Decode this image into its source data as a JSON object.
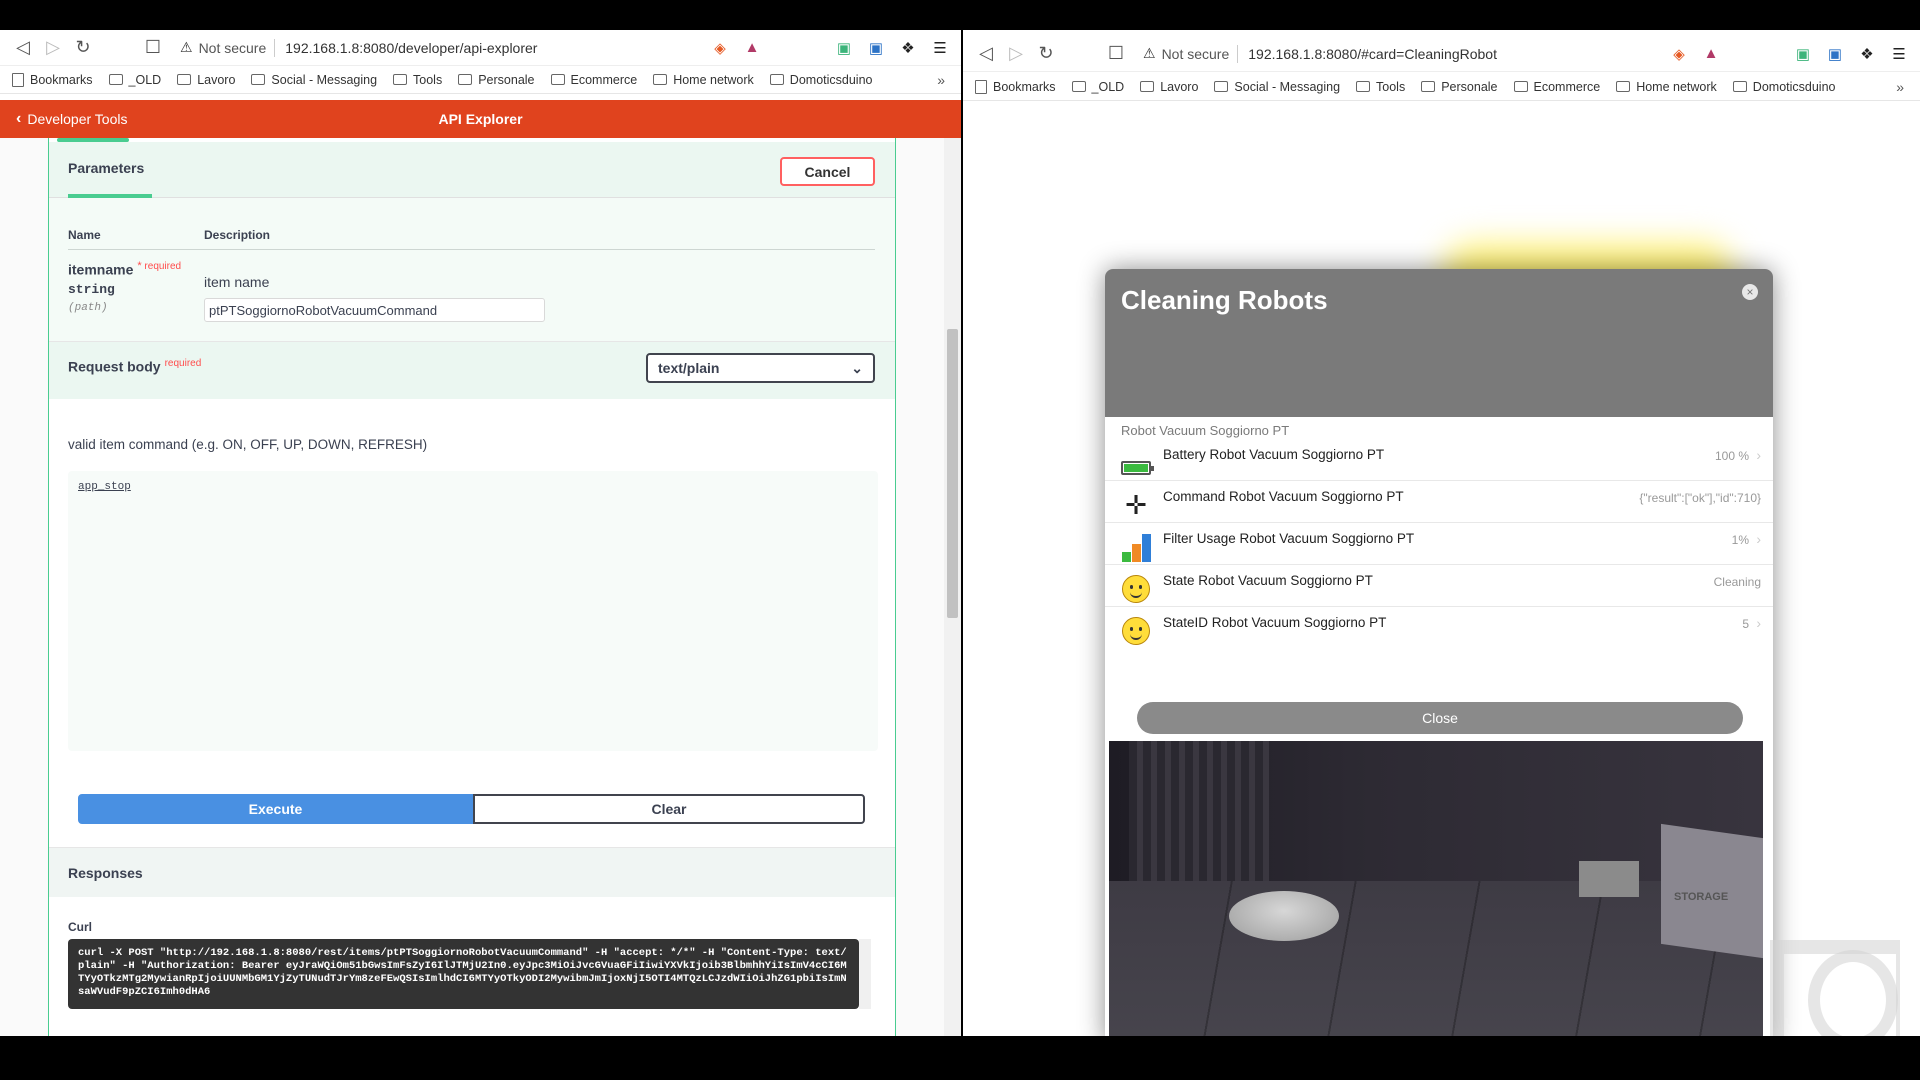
{
  "left": {
    "address": {
      "not_secure": "Not secure",
      "url": "192.168.1.8:8080/developer/api-explorer"
    },
    "bookmarks": [
      "Bookmarks",
      "_OLD",
      "Lavoro",
      "Social - Messaging",
      "Tools",
      "Personale",
      "Ecommerce",
      "Home network",
      "Domoticsduino"
    ],
    "more": "»",
    "header": {
      "back_label": "Developer Tools",
      "title": "API Explorer"
    },
    "parameters": {
      "tab": "Parameters",
      "cancel": "Cancel",
      "col_name": "Name",
      "col_desc": "Description",
      "param_name": "itemname",
      "required_star": "*",
      "required": "required",
      "param_type": "string",
      "param_in": "(path)",
      "param_desc": "item name",
      "param_value": "ptPTSoggiornoRobotVacuumCommand"
    },
    "request_body": {
      "title": "Request body",
      "required": "required",
      "content_type": "text/plain",
      "description": "valid item command (e.g. ON, OFF, UP, DOWN, REFRESH)",
      "body": "app_stop"
    },
    "execute": "Execute",
    "clear": "Clear",
    "responses": "Responses",
    "curl_label": "Curl",
    "curl": "curl -X POST \"http://192.168.1.8:8080/rest/items/ptPTSoggiornoRobotVacuumCommand\" -H \"accept: */*\" -H \"Content-Type: text/plain\" -H \"Authorization: Bearer eyJraWQiOm51bGwsImFsZyI6IlJTMjU2In0.eyJpc3MiOiJvcGVuaGFiIiwiYXVkIjoib3BlbmhhYiIsImV4cCI6MTYyOTkzMTg2MywianRpIjoiUUNMbGM1YjZyTUNudTJrYm8zeFEwQSIsImlhdCI6MTYyOTkyODI2MywibmJmIjoxNjI5OTI4MTQzLCJzdWIiOiJhZG1pbiIsImNsaWVudF9pZCI6Imh0dHA6"
  },
  "right": {
    "address": {
      "not_secure": "Not secure",
      "url": "192.168.1.8:8080/#card=CleaningRobot"
    },
    "bookmarks": [
      "Bookmarks",
      "_OLD",
      "Lavoro",
      "Social - Messaging",
      "Tools",
      "Personale",
      "Ecommerce",
      "Home network",
      "Domoticsduino"
    ],
    "more": "»",
    "modal": {
      "title": "Cleaning Robots",
      "close_x": "×",
      "group": "Robot Vacuum Soggiorno PT",
      "items": [
        {
          "label": "Battery Robot Vacuum Soggiorno PT",
          "value": "100 %",
          "icon": "battery-icon",
          "level": 1.0
        },
        {
          "label": "Command Robot Vacuum Soggiorno PT",
          "value": "{\"result\":[\"ok\"],\"id\":710}",
          "icon": "move-icon"
        },
        {
          "label": "Filter Usage Robot Vacuum Soggiorno PT",
          "value": "1%",
          "icon": "bar-chart-icon"
        },
        {
          "label": "State Robot Vacuum Soggiorno PT",
          "value": "Cleaning",
          "icon": "smiley-icon"
        },
        {
          "label": "StateID Robot Vacuum Soggiorno PT",
          "value": "5",
          "icon": "smiley-icon"
        }
      ],
      "close_button": "Close",
      "camera_text": "STORAGE"
    }
  },
  "colors": {
    "header": "#e0431e",
    "execute": "#4990e2",
    "green": "#49cc90",
    "cancel_border": "#ff6060"
  }
}
